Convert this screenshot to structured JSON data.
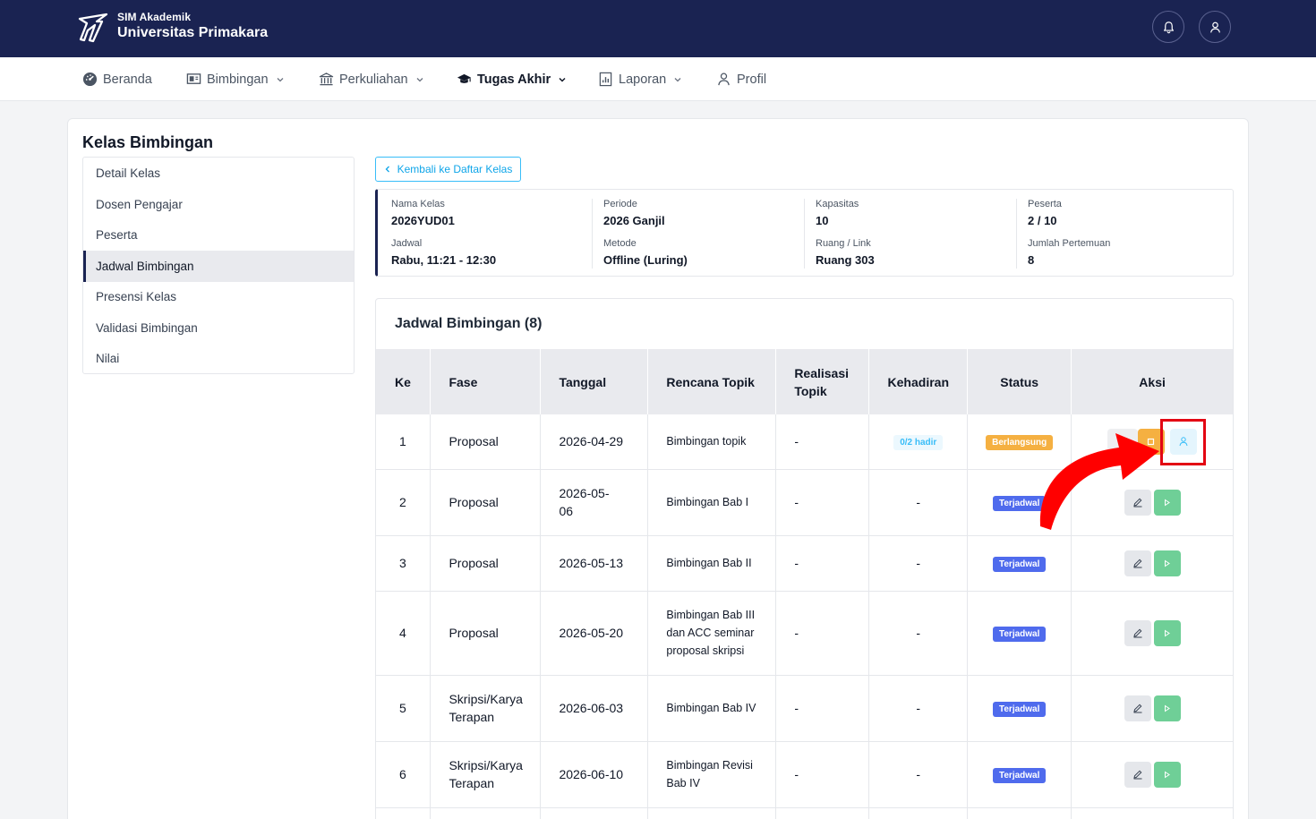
{
  "header": {
    "brand_sub": "SIM Akademik",
    "brand_main": "Universitas Primakara",
    "icons": [
      "bell-icon",
      "user-icon"
    ]
  },
  "nav": {
    "items": [
      {
        "label": "Beranda",
        "icon": "dashboard-icon",
        "dropdown": false
      },
      {
        "label": "Bimbingan",
        "icon": "board-icon",
        "dropdown": true
      },
      {
        "label": "Perkuliahan",
        "icon": "building-icon",
        "dropdown": true
      },
      {
        "label": "Tugas Akhir",
        "icon": "graduation-cap-icon",
        "dropdown": true,
        "active": true
      },
      {
        "label": "Laporan",
        "icon": "report-icon",
        "dropdown": true
      },
      {
        "label": "Profil",
        "icon": "user-icon",
        "dropdown": false
      }
    ]
  },
  "page": {
    "title": "Kelas Bimbingan",
    "back_label": "Kembali ke Daftar Kelas"
  },
  "side_menu": {
    "items": [
      "Detail Kelas",
      "Dosen Pengajar",
      "Peserta",
      "Jadwal Bimbingan",
      "Presensi Kelas",
      "Validasi Bimbingan",
      "Nilai"
    ],
    "active": "Jadwal Bimbingan"
  },
  "info": {
    "nama_kelas": {
      "label": "Nama Kelas",
      "value": "2026YUD01"
    },
    "periode": {
      "label": "Periode",
      "value": "2026 Ganjil"
    },
    "kapasitas": {
      "label": "Kapasitas",
      "value": "10"
    },
    "peserta": {
      "label": "Peserta",
      "value": "2 / 10"
    },
    "jadwal": {
      "label": "Jadwal",
      "value": "Rabu, 11:21 - 12:30"
    },
    "metode": {
      "label": "Metode",
      "value": "Offline (Luring)"
    },
    "ruang": {
      "label": "Ruang / Link",
      "value": "Ruang 303"
    },
    "jumlah": {
      "label": "Jumlah Pertemuan",
      "value": "8"
    }
  },
  "schedule": {
    "title": "Jadwal Bimbingan (8)",
    "columns": [
      "Ke",
      "Fase",
      "Tanggal",
      "Rencana Topik",
      "Realisasi Topik",
      "Kehadiran",
      "Status",
      "Aksi"
    ],
    "rows": [
      {
        "ke": "1",
        "fase": "Proposal",
        "tanggal": "2026-04-29",
        "topik": "Bimbingan topik",
        "realisasi": "-",
        "kehadiran": "0/2 hadir",
        "status": "Berlangsung"
      },
      {
        "ke": "2",
        "fase": "Proposal",
        "tanggal": "2026-05-06",
        "topik": "Bimbingan Bab I",
        "realisasi": "-",
        "kehadiran": "-",
        "status": "Terjadwal"
      },
      {
        "ke": "3",
        "fase": "Proposal",
        "tanggal": "2026-05-13",
        "topik": "Bimbingan Bab II",
        "realisasi": "-",
        "kehadiran": "-",
        "status": "Terjadwal"
      },
      {
        "ke": "4",
        "fase": "Proposal",
        "tanggal": "2026-05-20",
        "topik": "Bimbingan Bab III dan ACC seminar proposal skripsi",
        "realisasi": "-",
        "kehadiran": "-",
        "status": "Terjadwal"
      },
      {
        "ke": "5",
        "fase": "Skripsi/Karya Terapan",
        "tanggal": "2026-06-03",
        "topik": "Bimbingan Bab IV",
        "realisasi": "-",
        "kehadiran": "-",
        "status": "Terjadwal"
      },
      {
        "ke": "6",
        "fase": "Skripsi/Karya Terapan",
        "tanggal": "2026-06-10",
        "topik": "Bimbingan Revisi Bab IV",
        "realisasi": "-",
        "kehadiran": "-",
        "status": "Terjadwal"
      }
    ]
  },
  "colors": {
    "header_bg": "#1a2352",
    "accent": "#38bdf8",
    "status_running": "#f5b041",
    "status_scheduled": "#4f6bed",
    "play_button": "#6fcf97",
    "annotation": "#e30613"
  }
}
